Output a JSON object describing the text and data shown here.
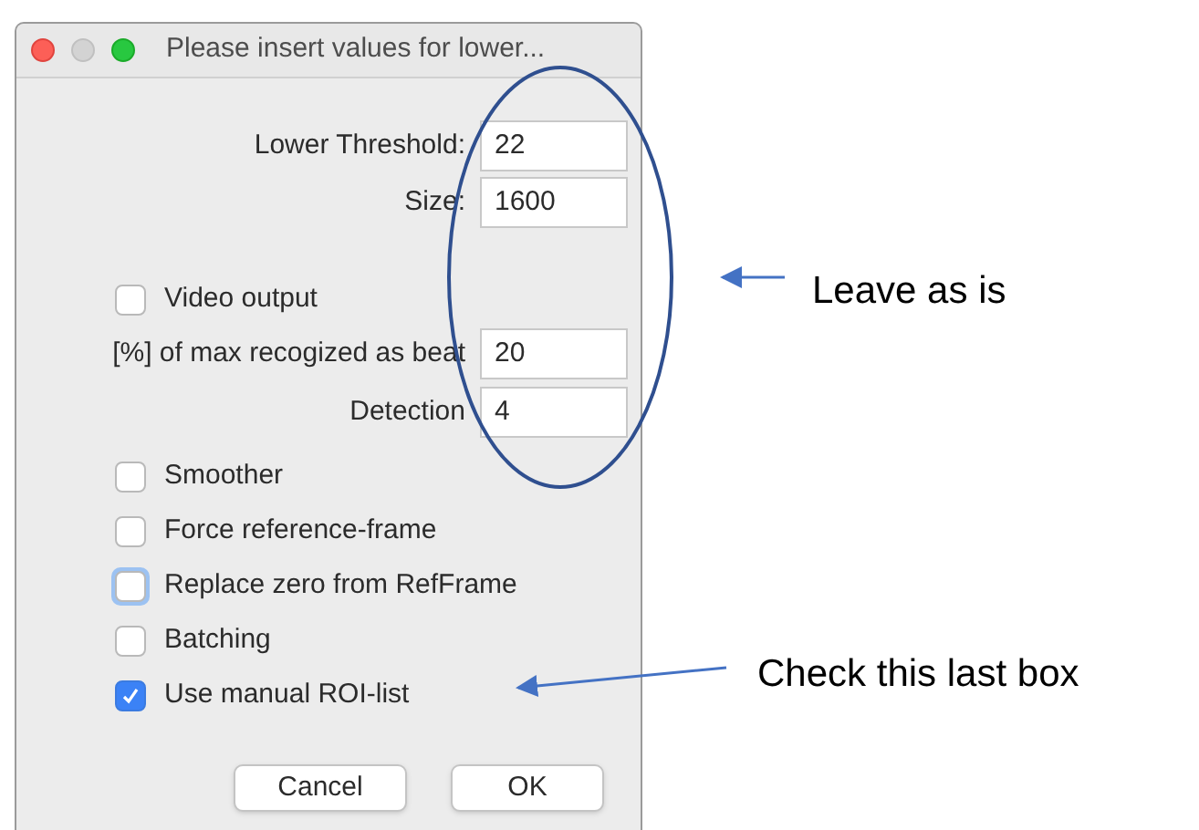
{
  "window": {
    "title": "Please insert values for lower..."
  },
  "threshold_fields": [
    {
      "label": "Lower Threshold:",
      "value": "22"
    },
    {
      "label": "Size:",
      "value": "1600"
    }
  ],
  "beat_options": [
    {
      "kind": "checkbox",
      "label": "Video output",
      "checked": false,
      "focused": false
    },
    {
      "kind": "field",
      "label": "[%] of max recogized as beat",
      "value": "20"
    },
    {
      "kind": "field",
      "label": "Detection",
      "value": "4"
    }
  ],
  "checkboxes": [
    {
      "label": "Smoother",
      "checked": false,
      "focused": false
    },
    {
      "label": "Force reference-frame",
      "checked": false,
      "focused": false
    },
    {
      "label": "Replace zero from RefFrame",
      "checked": false,
      "focused": true
    },
    {
      "label": "Batching",
      "checked": false,
      "focused": false
    },
    {
      "label": "Use manual ROI-list",
      "checked": true,
      "focused": false
    }
  ],
  "buttons": [
    "Cancel",
    "OK"
  ],
  "annotations": [
    "Leave as is",
    "Check this last box"
  ]
}
